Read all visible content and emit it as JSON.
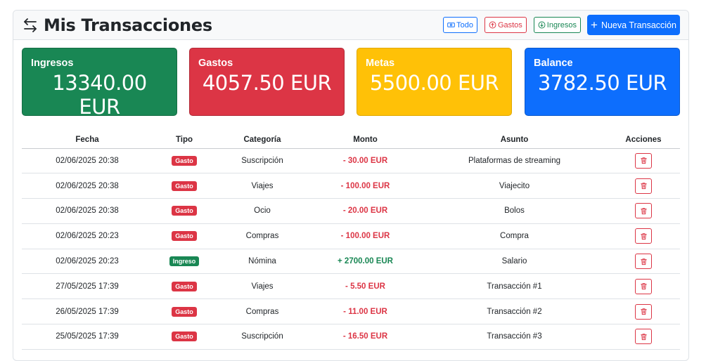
{
  "header": {
    "title": "Mis Transacciones",
    "filters": {
      "todo": "Todo",
      "gastos": "Gastos",
      "ingresos": "Ingresos"
    },
    "new_button": "Nueva Transacción"
  },
  "cards": {
    "ingresos": {
      "label": "Ingresos",
      "value": "13340.00 EUR",
      "color": "#198754"
    },
    "gastos": {
      "label": "Gastos",
      "value": "4057.50 EUR",
      "color": "#dc3545"
    },
    "metas": {
      "label": "Metas",
      "value": "5500.00 EUR",
      "color": "#ffc107"
    },
    "balance": {
      "label": "Balance",
      "value": "3782.50 EUR",
      "color": "#0d6efd"
    }
  },
  "table": {
    "columns": [
      "Fecha",
      "Tipo",
      "Categoría",
      "Monto",
      "Asunto",
      "Acciones"
    ],
    "rows": [
      {
        "fecha": "02/06/2025 20:38",
        "tipo": "Gasto",
        "categoria": "Suscripción",
        "monto": "- 30.00 EUR",
        "asunto": "Plataformas de streaming"
      },
      {
        "fecha": "02/06/2025 20:38",
        "tipo": "Gasto",
        "categoria": "Viajes",
        "monto": "- 100.00 EUR",
        "asunto": "Viajecito"
      },
      {
        "fecha": "02/06/2025 20:38",
        "tipo": "Gasto",
        "categoria": "Ocio",
        "monto": "- 20.00 EUR",
        "asunto": "Bolos"
      },
      {
        "fecha": "02/06/2025 20:23",
        "tipo": "Gasto",
        "categoria": "Compras",
        "monto": "- 100.00 EUR",
        "asunto": "Compra"
      },
      {
        "fecha": "02/06/2025 20:23",
        "tipo": "Ingreso",
        "categoria": "Nómina",
        "monto": "+ 2700.00 EUR",
        "asunto": "Salario"
      },
      {
        "fecha": "27/05/2025 17:39",
        "tipo": "Gasto",
        "categoria": "Viajes",
        "monto": "- 5.50 EUR",
        "asunto": "Transacción #1"
      },
      {
        "fecha": "26/05/2025 17:39",
        "tipo": "Gasto",
        "categoria": "Compras",
        "monto": "- 11.00 EUR",
        "asunto": "Transacción #2"
      },
      {
        "fecha": "25/05/2025 17:39",
        "tipo": "Gasto",
        "categoria": "Suscripción",
        "monto": "- 16.50 EUR",
        "asunto": "Transacción #3"
      }
    ]
  },
  "icons": {
    "title": "arrows-exchange-icon",
    "todo": "cash-icon",
    "gastos": "arrow-up-circle-icon",
    "ingresos": "arrow-down-circle-icon",
    "new": "plus-icon",
    "delete": "trash-icon"
  }
}
